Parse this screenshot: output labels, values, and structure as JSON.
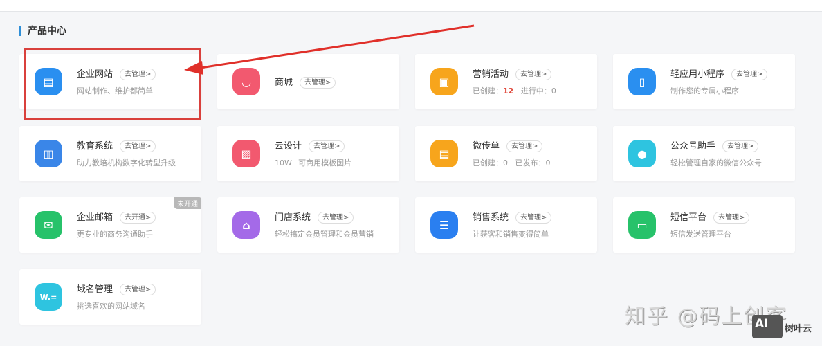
{
  "section_title": "产品中心",
  "manage_label": "去管理>",
  "open_label": "去开通>",
  "not_open_badge": "未开通",
  "cards": [
    {
      "title": "企业网站",
      "desc": "网站制作、维护都简单",
      "icon": "browser-icon",
      "color": "#2a8ff0"
    },
    {
      "title": "商城",
      "icon": "shopping-bag-icon",
      "color": "#f2596f"
    },
    {
      "title": "营销活动",
      "desc_label1": "已创建：",
      "value1": "12",
      "desc_label2": "进行中：",
      "value2": "0",
      "icon": "gift-icon",
      "color": "#f7a51c"
    },
    {
      "title": "轻应用小程序",
      "desc": "制作您的专属小程序",
      "icon": "mobile-app-icon",
      "color": "#2a8ff0"
    },
    {
      "title": "教育系统",
      "desc": "助力教培机构数字化转型升级",
      "icon": "book-icon",
      "color": "#3a86e8"
    },
    {
      "title": "云设计",
      "desc": "10W+可商用模板图片",
      "icon": "image-icon",
      "color": "#f2596f"
    },
    {
      "title": "微传单",
      "desc_label1": "已创建：",
      "value1": "0",
      "desc_label2": "已发布：",
      "value2": "0",
      "icon": "flyer-icon",
      "color": "#f7a51c"
    },
    {
      "title": "公众号助手",
      "desc": "轻松管理自家的微信公众号",
      "icon": "wechat-icon",
      "color": "#2ec4e0"
    },
    {
      "title": "企业邮箱",
      "desc": "更专业的商务沟通助手",
      "icon": "mail-icon",
      "color": "#27c26a"
    },
    {
      "title": "门店系统",
      "desc": "轻松搞定会员管理和会员营销",
      "icon": "store-icon",
      "color": "#a46ae8"
    },
    {
      "title": "销售系统",
      "desc": "让获客和销售变得简单",
      "icon": "list-icon",
      "color": "#2a7ff0"
    },
    {
      "title": "短信平台",
      "desc": "短信发送管理平台",
      "icon": "message-icon",
      "color": "#27c26a"
    },
    {
      "title": "域名管理",
      "desc": "挑选喜欢的网站域名",
      "icon": "domain-icon",
      "color": "#2ec4e0",
      "glyph": "W.="
    }
  ],
  "watermark": "知乎 @码上创客",
  "logo": {
    "mark": "AI",
    "text": "树叶云"
  }
}
